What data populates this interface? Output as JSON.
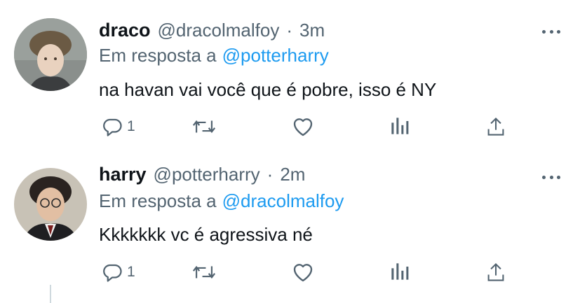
{
  "tweets": [
    {
      "name": "draco",
      "handle": "@dracolmalfoy",
      "separator": "·",
      "time": "3m",
      "reply_prefix": "Em resposta a",
      "reply_to": "@potterharry",
      "text": "na havan vai você que é pobre, isso é NY",
      "reply_count": "1",
      "avatar_icon": "avatar-draco"
    },
    {
      "name": "harry",
      "handle": "@potterharry",
      "separator": "·",
      "time": "2m",
      "reply_prefix": "Em resposta a",
      "reply_to": "@dracolmalfoy",
      "text": "Kkkkkkk vc é agressiva né",
      "reply_count": "1",
      "avatar_icon": "avatar-harry"
    }
  ],
  "icons": {
    "reply": "reply-icon",
    "retweet": "retweet-icon",
    "like": "heart-icon",
    "analytics": "analytics-icon",
    "share": "share-icon",
    "more": "more-icon"
  },
  "colors": {
    "link": "#1d9bf0",
    "secondary": "#536471",
    "primary_text": "#0f1419"
  }
}
